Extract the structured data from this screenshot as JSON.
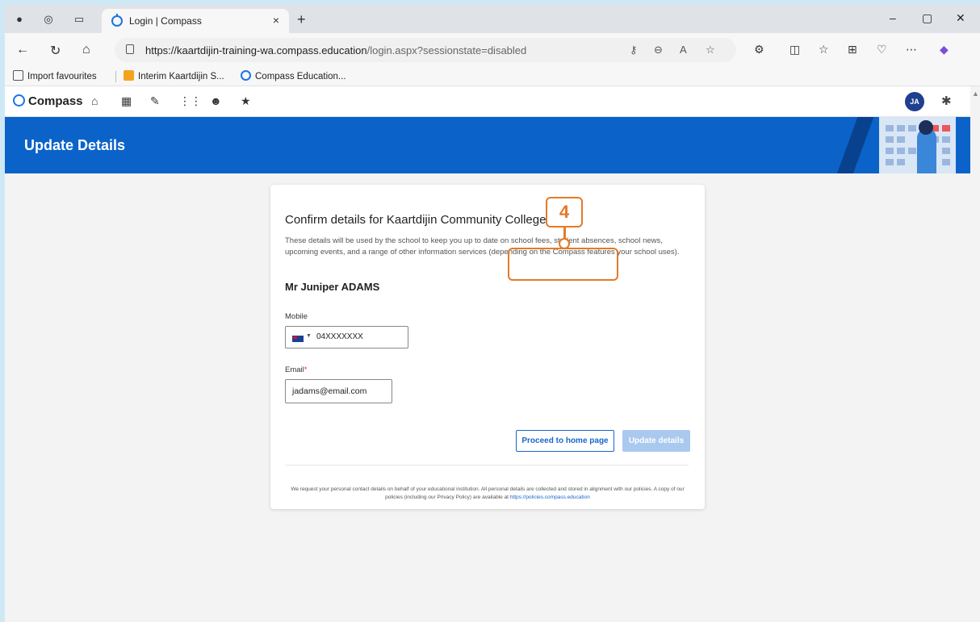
{
  "browser": {
    "tab_title": "Login | Compass",
    "tab_close": "×",
    "new_tab": "+",
    "url_host": "https://kaartdijin-training-wa.compass.education",
    "url_path": "/login.aspx?sessionstate=disabled",
    "window_minimize": "–",
    "window_maximize": "▢",
    "window_close": "✕"
  },
  "favourites": {
    "items": [
      "Import favourites",
      "Interim Kaartdijin S...",
      "Compass Education..."
    ]
  },
  "compass_nav": {
    "logo": "Compass",
    "avatar_initials": "JA"
  },
  "banner": {
    "title": "Update Details"
  },
  "form": {
    "heading": "Confirm details for Kaartdijin Community College",
    "description": "These details will be used by the school to keep you up to date on school fees, student absences, school news, upcoming events, and a range of other information services (depending on the Compass features your school uses).",
    "user_name": "Mr Juniper ADAMS",
    "mobile_label": "Mobile",
    "mobile_value": "04XXXXXXX",
    "email_label": "Email",
    "email_required": "*",
    "email_value": "jadams@email.com",
    "proceed_button": "Proceed to home page",
    "update_button": "Update details",
    "footer_text": "We request your personal contact details on behalf of your educational institution. All personal details are collected and stored in alignment with our policies. A copy of our policies (including our Privacy Policy) are available at",
    "footer_link": "https://policies.compass.education"
  },
  "annotation": {
    "step_number": "4",
    "color": "#e57a28"
  },
  "colors": {
    "brand_blue": "#0b63c9",
    "button_blue": "#1a66c9",
    "disabled_blue": "#a9c9ef"
  }
}
